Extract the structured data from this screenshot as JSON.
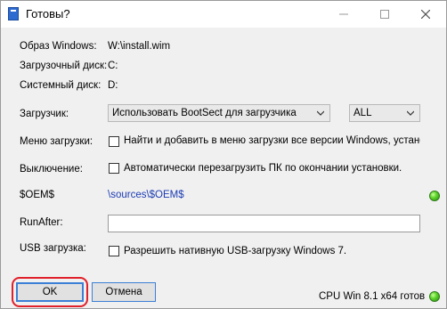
{
  "window": {
    "title": "Готовы?",
    "icon": "app-icon",
    "controls": [
      "minimize-icon",
      "maximize-icon",
      "close-icon"
    ]
  },
  "info": {
    "image_label": "Образ Windows:",
    "image_value": "W:\\install.wim",
    "boot_disk_label": "Загрузочный диск:",
    "boot_disk_value": "C:",
    "system_disk_label": "Системный диск:",
    "system_disk_value": "D:"
  },
  "bootloader": {
    "label": "Загрузчик:",
    "selected": "Использовать BootSect для загрузчика",
    "target_selected": "ALL"
  },
  "boot_menu": {
    "label": "Меню загрузки:",
    "checkbox_label": "Найти и добавить в меню загрузки все версии Windows, установ",
    "checked": false
  },
  "shutdown": {
    "label": "Выключение:",
    "checkbox_label": "Автоматически перезагрузить ПК по окончании установки.",
    "checked": false
  },
  "oem": {
    "label": "$OEM$",
    "path": "\\sources\\$OEM$",
    "status_color": "#5fd62a"
  },
  "run_after": {
    "label": "RunAfter:",
    "value": ""
  },
  "usb": {
    "label": "USB загрузка:",
    "checkbox_label": "Разрешить нативную USB-загрузку Windows 7.",
    "checked": false
  },
  "footer": {
    "ok_label": "OK",
    "cancel_label": "Отмена",
    "status_text": "CPU Win 8.1 x64 готов",
    "status_color": "#5fd62a",
    "highlight_color": "#e0202a"
  }
}
